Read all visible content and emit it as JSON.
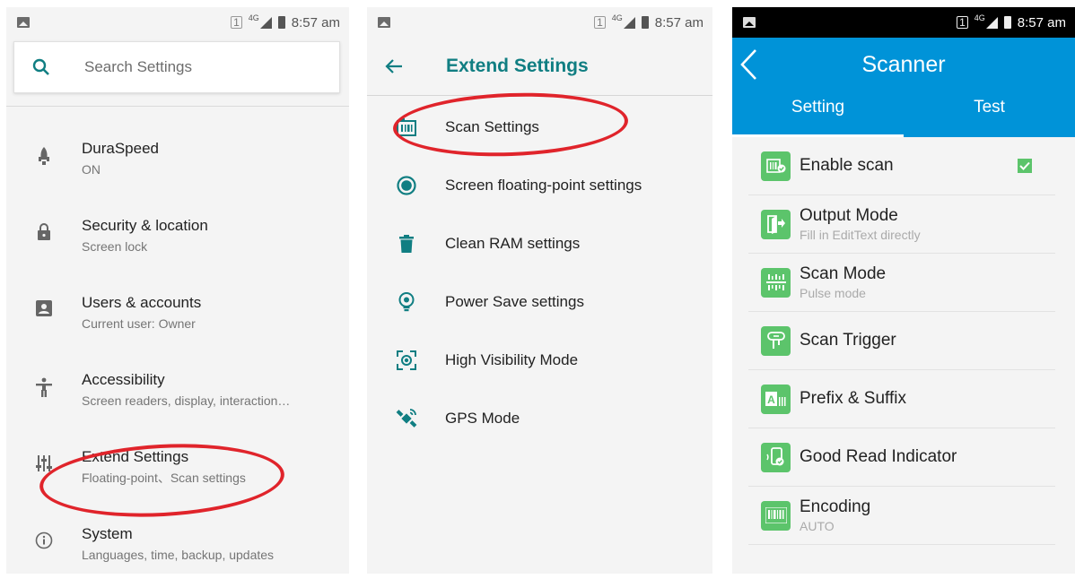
{
  "panel1": {
    "status_time": "8:57 am",
    "status_sim": "1",
    "status_net": "4G",
    "search_placeholder": "Search Settings",
    "items": [
      {
        "title": "DuraSpeed",
        "subtitle": "ON",
        "icon": "rocket-icon"
      },
      {
        "title": "Security & location",
        "subtitle": "Screen lock",
        "icon": "lock-icon"
      },
      {
        "title": "Users & accounts",
        "subtitle": "Current user: Owner",
        "icon": "account-box-icon"
      },
      {
        "title": "Accessibility",
        "subtitle": "Screen readers, display, interaction…",
        "icon": "accessibility-icon"
      },
      {
        "title": "Extend Settings",
        "subtitle": "Floating-point、Scan settings",
        "icon": "sliders-icon"
      },
      {
        "title": "System",
        "subtitle": "Languages, time, backup, updates",
        "icon": "info-icon"
      }
    ]
  },
  "panel2": {
    "status_time": "8:57 am",
    "status_sim": "1",
    "status_net": "4G",
    "title": "Extend Settings",
    "items": [
      {
        "title": "Scan Settings",
        "icon": "scan-settings-icon"
      },
      {
        "title": "Screen floating-point settings",
        "icon": "floating-point-icon"
      },
      {
        "title": "Clean RAM settings",
        "icon": "trash-icon"
      },
      {
        "title": "Power Save settings",
        "icon": "power-save-icon"
      },
      {
        "title": "High Visibility Mode",
        "icon": "high-visibility-icon"
      },
      {
        "title": "GPS Mode",
        "icon": "satellite-icon"
      }
    ]
  },
  "panel3": {
    "status_time": "8:57 am",
    "status_sim": "1",
    "status_net": "4G",
    "title": "Scanner",
    "tabs": [
      "Setting",
      "Test"
    ],
    "items": [
      {
        "title": "Enable scan",
        "subtitle": "",
        "icon": "enable-scan-icon",
        "checked": true
      },
      {
        "title": "Output Mode",
        "subtitle": "Fill in EditText directly",
        "icon": "output-mode-icon"
      },
      {
        "title": "Scan Mode",
        "subtitle": "Pulse mode",
        "icon": "scan-mode-icon"
      },
      {
        "title": "Scan Trigger",
        "subtitle": "",
        "icon": "scan-trigger-icon"
      },
      {
        "title": "Prefix & Suffix",
        "subtitle": "",
        "icon": "prefix-suffix-icon"
      },
      {
        "title": "Good Read Indicator",
        "subtitle": "",
        "icon": "good-read-icon"
      },
      {
        "title": "Encoding",
        "subtitle": "AUTO",
        "icon": "barcode-icon"
      }
    ]
  },
  "colors": {
    "teal_accent": "#107e82",
    "scanner_blue": "#0093d8",
    "icon_green": "#5cc46b",
    "highlight_red": "#e0242b"
  }
}
